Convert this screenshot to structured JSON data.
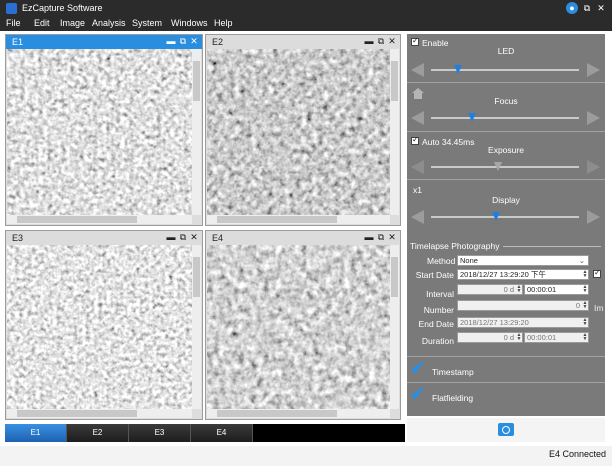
{
  "window": {
    "title": "EzCapture Software"
  },
  "menu": [
    "File",
    "Edit",
    "Image",
    "Analysis",
    "System",
    "Windows",
    "Help"
  ],
  "panes": [
    {
      "label": "E1",
      "active": true
    },
    {
      "label": "E2",
      "active": false
    },
    {
      "label": "E3",
      "active": false
    },
    {
      "label": "E4",
      "active": false
    }
  ],
  "tabs": [
    "E1",
    "E2",
    "E3",
    "E4"
  ],
  "selected_tab": "E1",
  "status": "E4 Connected",
  "controls": {
    "led": {
      "enable_label": "Enable",
      "enabled": true,
      "title": "LED",
      "level": 0.18
    },
    "focus": {
      "title": "Focus",
      "level": 0.28
    },
    "exposure": {
      "auto_label": "Auto 34.45ms",
      "auto": true,
      "title": "Exposure",
      "level": 0.45
    },
    "display": {
      "zoom": "x1",
      "title": "Display",
      "level": 0.44
    }
  },
  "timelapse": {
    "header": "Timelapse Photography",
    "method_label": "Method",
    "method_value": "None",
    "start_label": "Start Date",
    "start_value": "2018/12/27 13:29:20 下午",
    "interval_label": "Interval",
    "interval_days": "0 d",
    "interval_time": "00:00:01",
    "number_label": "Number",
    "number_value": "0",
    "number_unit": "Im",
    "end_label": "End Date",
    "end_value": "2018/12/27 13:29:20",
    "duration_label": "Duration",
    "duration_days": "0 d",
    "duration_time": "00:00:01"
  },
  "options": {
    "timestamp": "Timestamp",
    "flatfielding": "Flatfielding"
  },
  "colors": {
    "accent": "#2a8ee0",
    "titlebar": "#2b2b2b",
    "panel": "#7a7a7a"
  }
}
